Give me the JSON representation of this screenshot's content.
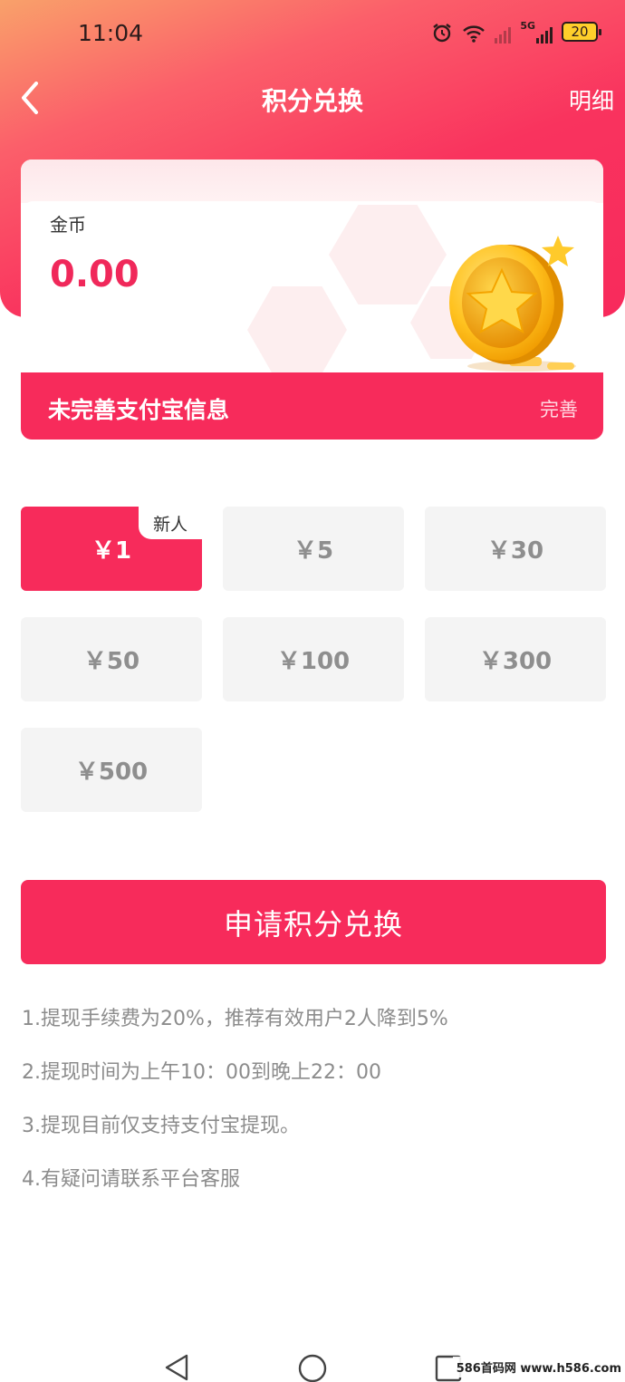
{
  "status_bar": {
    "time": "11:04",
    "network": "5G",
    "battery": "20"
  },
  "nav": {
    "title": "积分兑换",
    "detail_link": "明细"
  },
  "balance": {
    "label": "金币",
    "value": "0.00"
  },
  "alipay": {
    "notice": "未完善支付宝信息",
    "action": "完善"
  },
  "amounts": [
    {
      "label": "￥1",
      "tag": "新人",
      "selected": true
    },
    {
      "label": "￥5"
    },
    {
      "label": "￥30"
    },
    {
      "label": "￥50"
    },
    {
      "label": "￥100"
    },
    {
      "label": "￥300"
    },
    {
      "label": "￥500"
    }
  ],
  "submit_label": "申请积分兑换",
  "rules": [
    "1.提现手续费为20%，推荐有效用户2人降到5%",
    "2.提现时间为上午10：00到晚上22：00",
    "3.提现目前仅支持支付宝提现。",
    "4.有疑问请联系平台客服"
  ],
  "watermark": "586首码网 www.h586.com",
  "colors": {
    "accent": "#f72b5b",
    "coin_value": "#f0285a",
    "rules_text": "#8c8c8c",
    "amount_bg": "#f4f4f4"
  },
  "icons": [
    "alarm-icon",
    "wifi-icon",
    "signal-icon",
    "battery-icon",
    "back-arrow-icon",
    "coin-star-icon",
    "nav-back-icon",
    "nav-home-icon",
    "nav-recents-icon"
  ]
}
